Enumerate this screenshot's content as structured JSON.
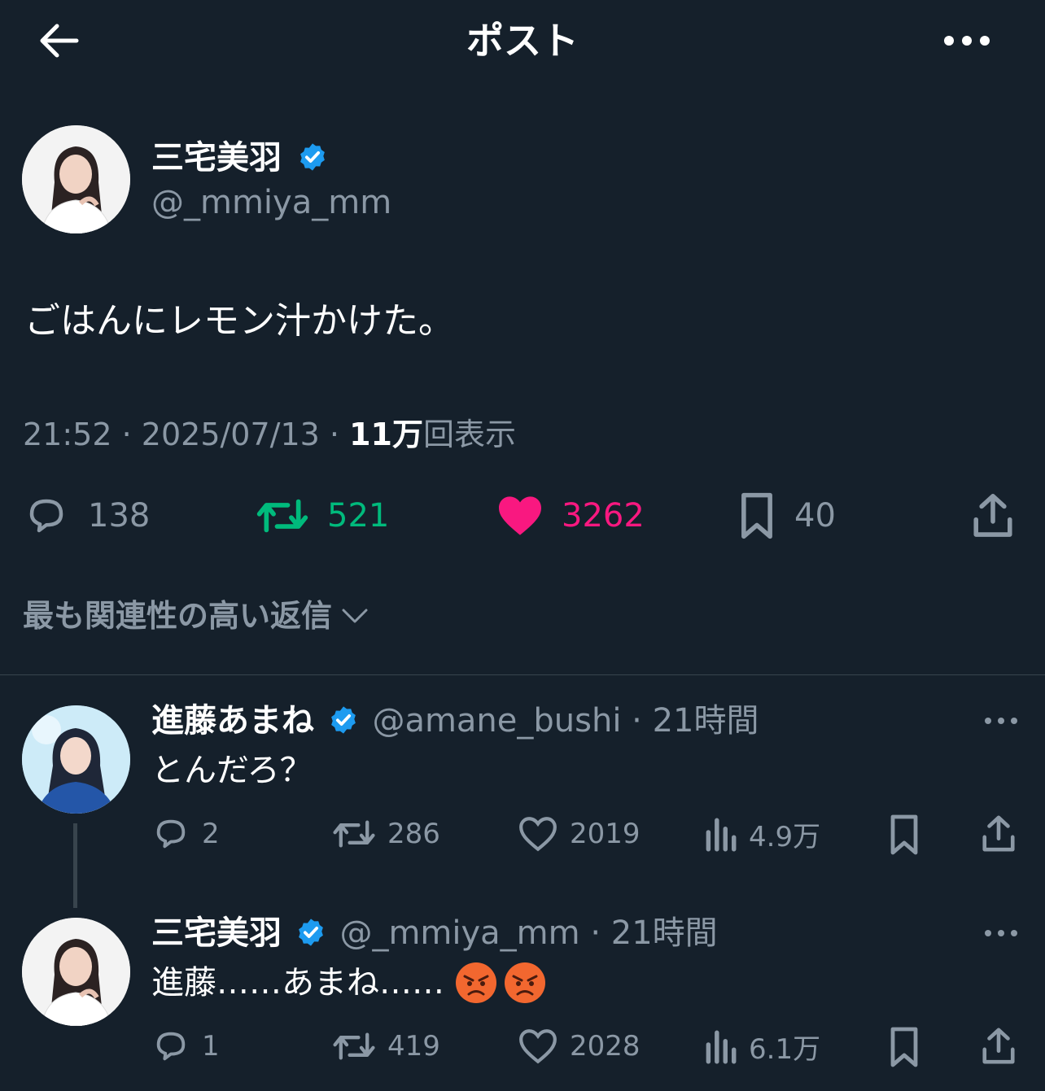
{
  "header": {
    "title": "ポスト",
    "back_icon": "arrow-left-icon",
    "more_icon": "more-horizontal-icon"
  },
  "post": {
    "author_name": "三宅美羽",
    "handle": "@_mmiya_mm",
    "text": "ごはんにレモン汁かけた。",
    "time": "21:52",
    "date": "2025/07/13",
    "views_count": "11万",
    "views_label": "回表示",
    "stats": {
      "replies": "138",
      "retweets": "521",
      "likes": "3262",
      "bookmarks": "40"
    }
  },
  "sort": {
    "label": "最も関連性の高い返信"
  },
  "replies": [
    {
      "author_name": "進藤あまね",
      "handle": "@amane_bushi",
      "time": "21時間",
      "text": "とんだろ？",
      "stats": {
        "replies": "2",
        "retweets": "286",
        "likes": "2019",
        "views": "4.9万"
      }
    },
    {
      "author_name": "三宅美羽",
      "handle": "@_mmiya_mm",
      "time": "21時間",
      "text": "進藤……あまね……",
      "emoji": "😡😡",
      "stats": {
        "replies": "1",
        "retweets": "419",
        "likes": "2028",
        "views": "6.1万"
      }
    }
  ],
  "colors": {
    "background": "#15202b",
    "retweet": "#00ba7c",
    "like": "#f91880",
    "verified": "#1d9bf0",
    "muted": "#8b98a5"
  },
  "separator": "·"
}
